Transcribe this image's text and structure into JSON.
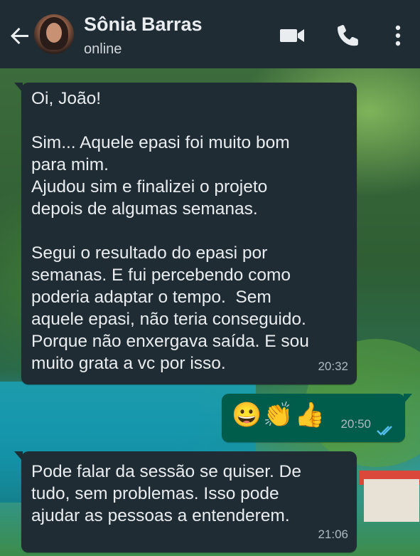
{
  "header": {
    "contact_name": "Sônia Barras",
    "status": "online",
    "icons": [
      "back-arrow-icon",
      "avatar",
      "video-call-icon",
      "phone-icon",
      "more-options-icon"
    ]
  },
  "messages": [
    {
      "direction": "incoming",
      "text": "Oi, João!\n\nSim... Aquele epasi foi muito bom\npara mim.\nAjudou sim e finalizei o projeto\ndepois de algumas semanas.\n\nSegui o resultado do epasi por\nsemanas. E fui percebendo como\npoderia adaptar o tempo.  Sem\naquele epasi, não teria conseguido.\nPorque não enxergava saída. E sou\nmuito grata a vc por isso.",
      "time": "20:32"
    },
    {
      "direction": "outgoing",
      "text": "😀👏👍",
      "time": "20:50",
      "status": "read"
    },
    {
      "direction": "incoming",
      "text": "Pode falar da sessão se quiser. De\ntudo, sem problemas. Isso pode\najudar as pessoas a entenderem.",
      "time": "21:06"
    }
  ],
  "colors": {
    "header_bg": "#1f2c34",
    "incoming_bubble": "#1f2c34",
    "outgoing_bubble": "#005c4b",
    "read_tick": "#53bdeb",
    "text": "#e9edef",
    "time_text": "#aebac1"
  }
}
